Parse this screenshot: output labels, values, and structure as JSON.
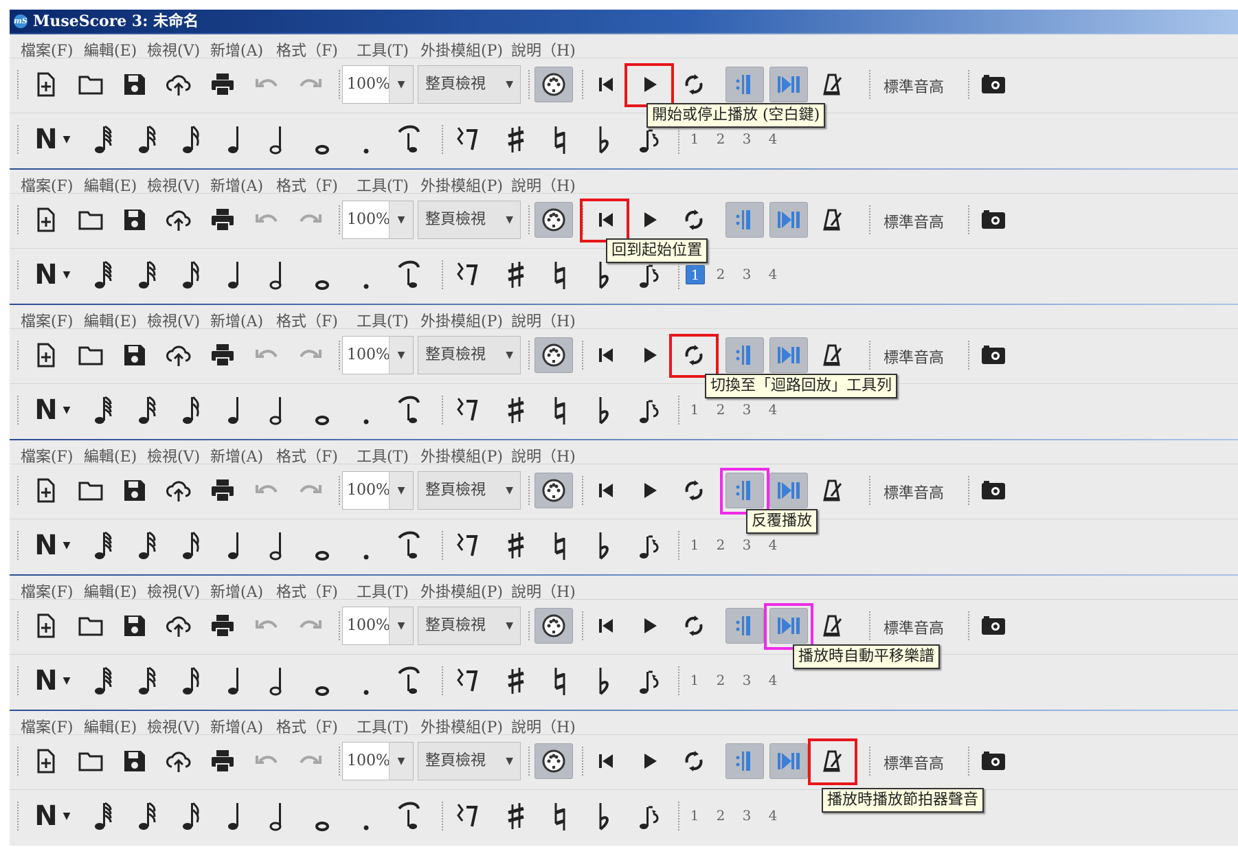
{
  "app": {
    "title": "MuseScore 3: 未命名",
    "icon": "musescore-logo-icon"
  },
  "menu": [
    "檔案(F)",
    "編輯(E)",
    "檢視(V)",
    "新增(A)",
    "格式（F)",
    "工具(T)",
    "外掛模組(P)",
    "說明（H)"
  ],
  "toolbar": {
    "zoom": "100%",
    "view_mode": "整頁檢視",
    "concert_pitch": "標準音高",
    "icons": [
      "new-score-icon",
      "open-folder-icon",
      "save-icon",
      "upload-cloud-icon",
      "print-icon",
      "undo-icon",
      "redo-icon",
      "midi-input-icon",
      "rewind-icon",
      "play-icon",
      "loop-icon",
      "repeat-play-icon",
      "pan-score-icon",
      "metronome-icon",
      "camera-icon"
    ]
  },
  "note_input": {
    "icons": [
      "note-input-n-icon",
      "chevron-down-icon",
      "64th-note-icon",
      "32nd-note-icon",
      "16th-note-icon",
      "quarter-note-icon",
      "half-note-icon",
      "whole-note-icon",
      "dot-icon",
      "tie-icon",
      "rest-icon",
      "sharp-icon",
      "natural-icon",
      "flat-icon",
      "flip-icon"
    ],
    "voices": [
      "1",
      "2",
      "3",
      "4"
    ]
  },
  "panels": [
    {
      "highlight": "play",
      "highlight_color": "#e8161b",
      "tooltip": "開始或停止播放 (空白鍵)",
      "active_voice": ""
    },
    {
      "highlight": "rewind",
      "highlight_color": "#e8161b",
      "tooltip": "回到起始位置",
      "active_voice": "1"
    },
    {
      "highlight": "loop",
      "highlight_color": "#e8161b",
      "tooltip": "切換至「迴路回放」工具列",
      "active_voice": ""
    },
    {
      "highlight": "repeat",
      "highlight_color": "#ee2ce8",
      "tooltip": "反覆播放",
      "active_voice": ""
    },
    {
      "highlight": "pan",
      "highlight_color": "#ee2ce8",
      "tooltip": "播放時自動平移樂譜",
      "active_voice": ""
    },
    {
      "highlight": "metronome",
      "highlight_color": "#e8161b",
      "tooltip": "播放時播放節拍器聲音",
      "active_voice": ""
    }
  ]
}
